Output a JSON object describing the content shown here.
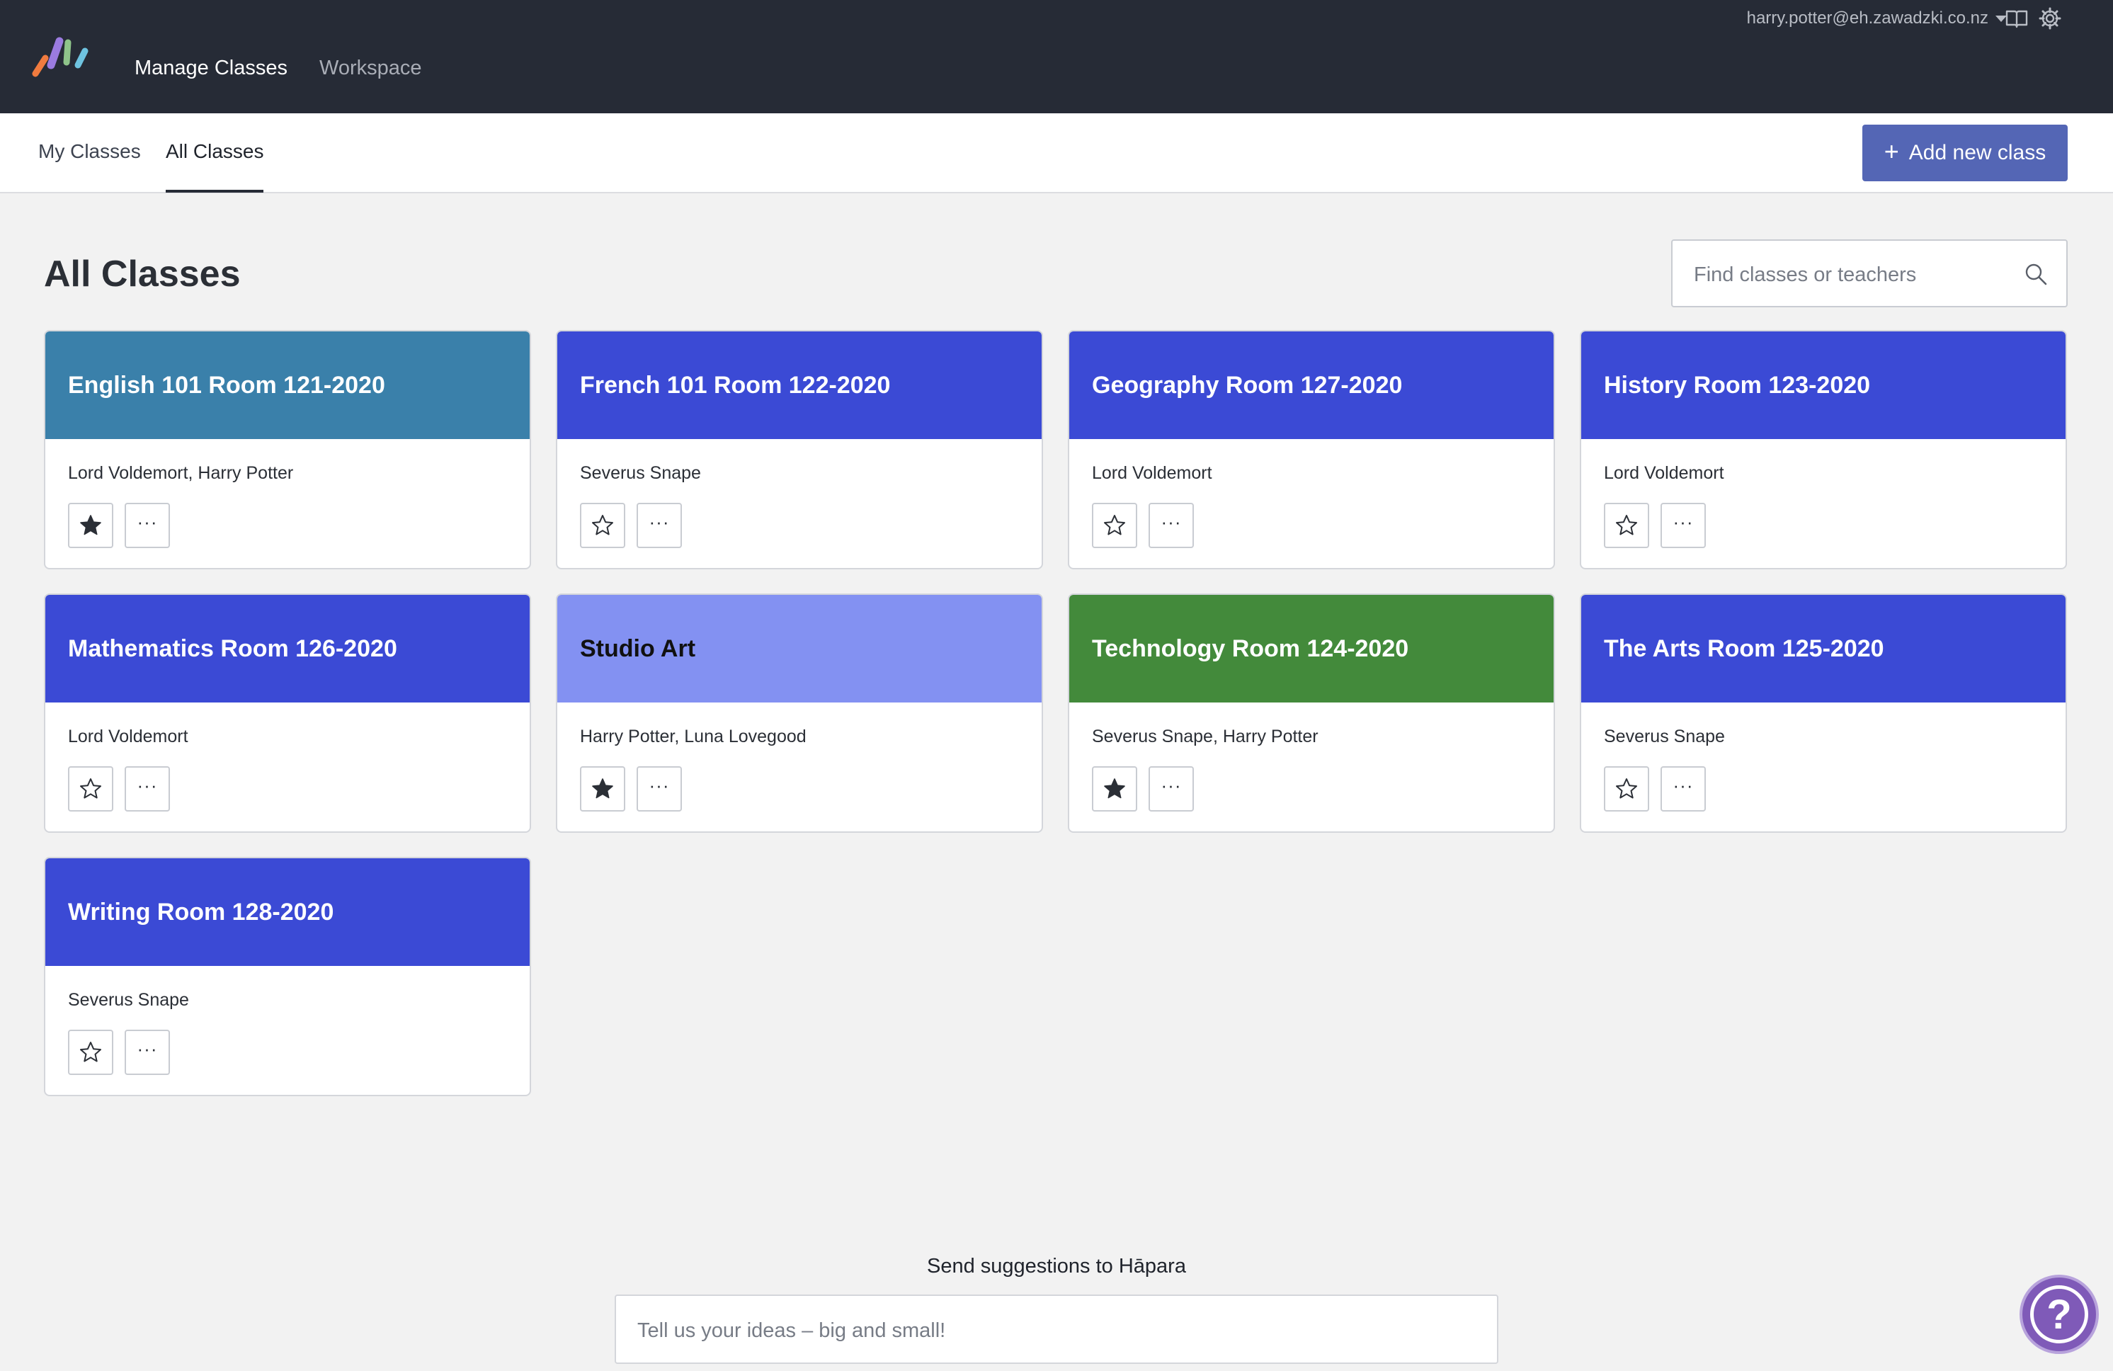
{
  "topbar": {
    "logo_icon": "hapara-logo-icon",
    "nav": [
      {
        "label": "Manage Classes",
        "active": true
      },
      {
        "label": "Workspace",
        "active": false
      }
    ],
    "account_email": "harry.potter@eh.zawadzki.co.nz",
    "icons": [
      "book-icon",
      "gear-icon"
    ]
  },
  "subnav": {
    "tabs": [
      {
        "label": "My Classes",
        "active": false
      },
      {
        "label": "All Classes",
        "active": true
      }
    ],
    "add_button_label": "Add new class"
  },
  "main": {
    "title": "All Classes",
    "search_placeholder": "Find classes or teachers",
    "more_label": "···",
    "classes": [
      {
        "name": "English 101 Room 121-2020",
        "teachers": "Lord Voldemort, Harry Potter",
        "color": "#3a80aa",
        "title_color": "#ffffff",
        "starred": true
      },
      {
        "name": "French 101 Room 122-2020",
        "teachers": "Severus Snape",
        "color": "#3b4ad5",
        "title_color": "#ffffff",
        "starred": false
      },
      {
        "name": "Geography Room 127-2020",
        "teachers": "Lord Voldemort",
        "color": "#3b4ad5",
        "title_color": "#ffffff",
        "starred": false
      },
      {
        "name": "History Room 123-2020",
        "teachers": "Lord Voldemort",
        "color": "#3b4ad5",
        "title_color": "#ffffff",
        "starred": false
      },
      {
        "name": "Mathematics Room 126-2020",
        "teachers": "Lord Voldemort",
        "color": "#3b4ad5",
        "title_color": "#ffffff",
        "starred": false
      },
      {
        "name": "Studio Art",
        "teachers": "Harry Potter, Luna Lovegood",
        "color": "#8391f2",
        "title_color": "#111111",
        "starred": true
      },
      {
        "name": "Technology Room 124-2020",
        "teachers": "Severus Snape, Harry Potter",
        "color": "#438a3b",
        "title_color": "#ffffff",
        "starred": true
      },
      {
        "name": "The Arts Room 125-2020",
        "teachers": "Severus Snape",
        "color": "#3b4ad5",
        "title_color": "#ffffff",
        "starred": false
      },
      {
        "name": "Writing Room 128-2020",
        "teachers": "Severus Snape",
        "color": "#3b4ad5",
        "title_color": "#ffffff",
        "starred": false
      }
    ]
  },
  "footer": {
    "suggest_label": "Send suggestions to Hāpara",
    "suggest_placeholder": "Tell us your ideas – big and small!",
    "help_icon": "help-icon",
    "help_label": "?"
  }
}
